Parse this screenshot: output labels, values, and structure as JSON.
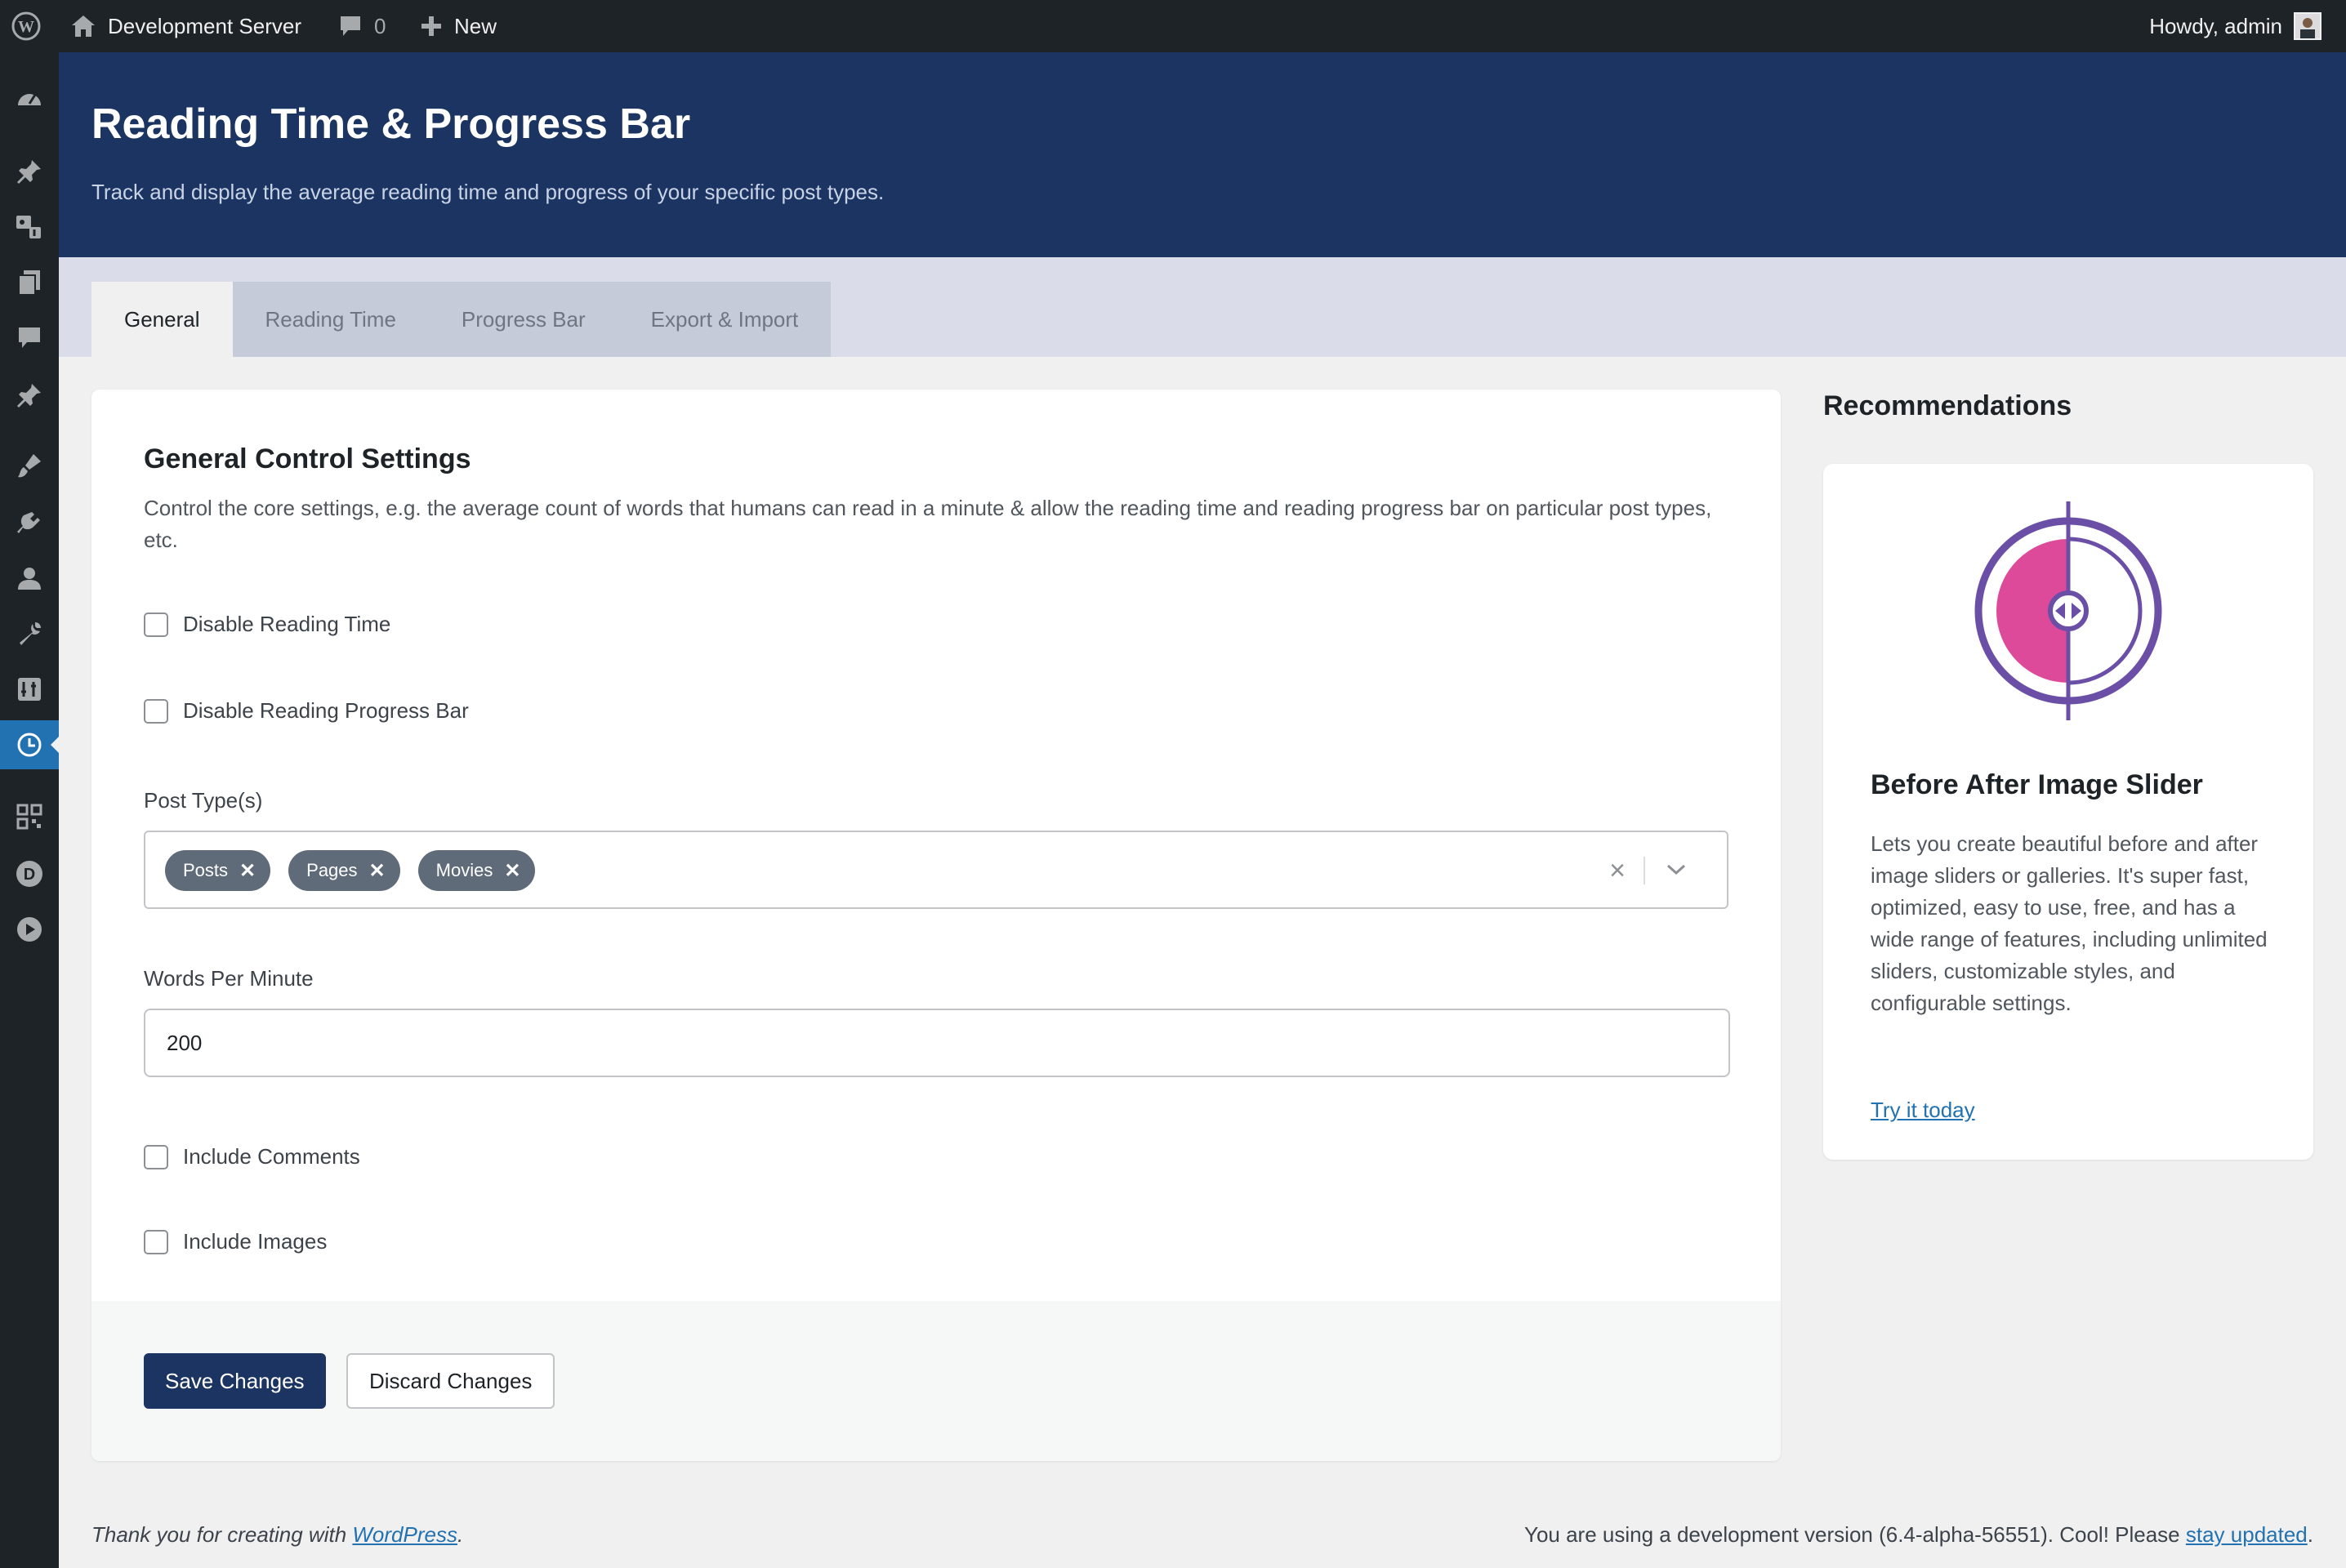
{
  "adminbar": {
    "site_name": "Development Server",
    "comment_count": "0",
    "new_label": "New",
    "howdy": "Howdy, admin"
  },
  "page": {
    "title": "Reading Time & Progress Bar",
    "subtitle": "Track and display the average reading time and progress of your specific post types."
  },
  "tabs": [
    {
      "label": "General",
      "active": true
    },
    {
      "label": "Reading Time",
      "active": false
    },
    {
      "label": "Progress Bar",
      "active": false
    },
    {
      "label": "Export & Import",
      "active": false
    }
  ],
  "settings": {
    "heading": "General Control Settings",
    "description": "Control the core settings, e.g. the average count of words that humans can read in a minute & allow the reading time and reading progress bar on particular post types, etc.",
    "disable_reading_time": {
      "label": "Disable Reading Time",
      "checked": false
    },
    "disable_progress_bar": {
      "label": "Disable Reading Progress Bar",
      "checked": false
    },
    "post_types": {
      "label": "Post Type(s)",
      "selected": [
        "Posts",
        "Pages",
        "Movies"
      ]
    },
    "words_per_minute": {
      "label": "Words Per Minute",
      "value": "200"
    },
    "include_comments": {
      "label": "Include Comments",
      "checked": false
    },
    "include_images": {
      "label": "Include Images",
      "checked": false
    },
    "save_label": "Save Changes",
    "discard_label": "Discard Changes"
  },
  "recommendations": {
    "title": "Recommendations",
    "plugin_name": "Before After Image Slider",
    "plugin_description": "Lets you create beautiful before and after image sliders or galleries. It's super fast, optimized, easy to use, free, and has a wide range of features, including unlimited sliders, customizable styles, and configurable settings.",
    "cta": "Try it today"
  },
  "footer": {
    "thanks_prefix": "Thank you for creating with ",
    "thanks_link": "WordPress",
    "thanks_suffix": ".",
    "version_text": "You are using a development version (6.4-alpha-56551). Cool! Please ",
    "version_link": "stay updated",
    "version_suffix": "."
  },
  "colors": {
    "header_bg": "#1b3461",
    "admin_bar": "#1d2327",
    "active_menu": "#2271b1",
    "chip_bg": "#5f6b79",
    "logo_purple": "#6b4fa6",
    "logo_pink": "#dd4a9a"
  },
  "icons": {
    "sidebar": [
      "dashboard-icon",
      "pin-icon",
      "media-icon",
      "pages-icon",
      "comments-icon",
      "pin-icon",
      "appearance-icon",
      "plugins-icon",
      "users-icon",
      "tools-icon",
      "settings-icon",
      "clock-icon",
      "qr-icon",
      "d-circle-icon",
      "play-icon"
    ]
  }
}
